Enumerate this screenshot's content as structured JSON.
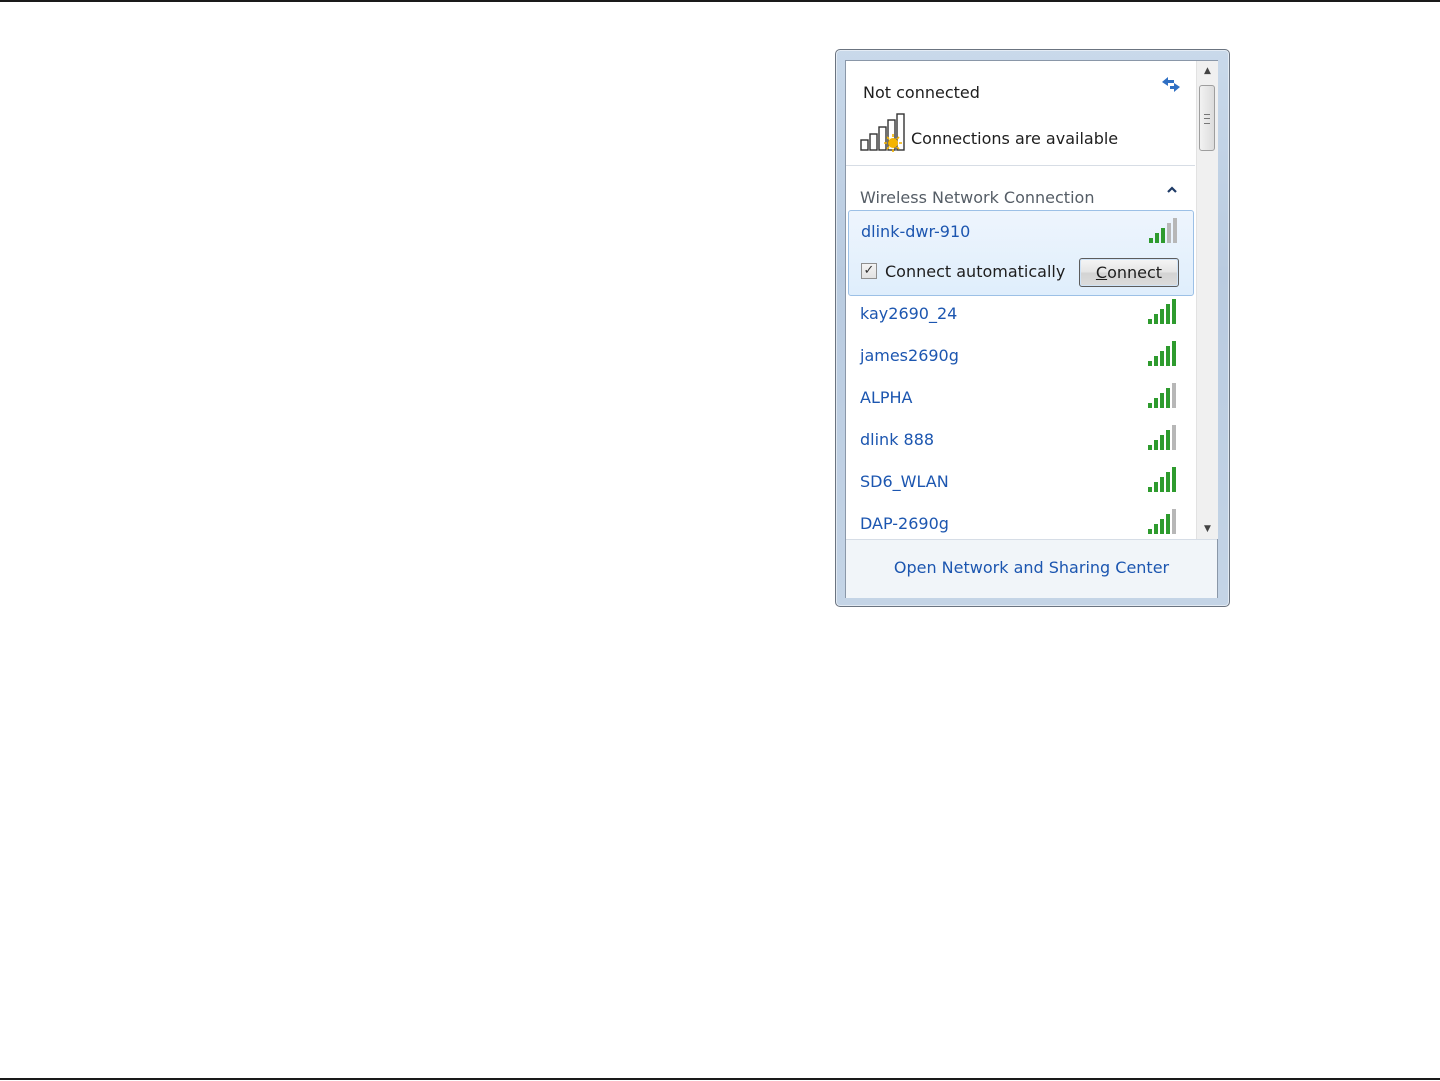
{
  "flyout": {
    "status_title": "Not connected",
    "availability_text": "Connections are available",
    "section_title": "Wireless Network Connection",
    "selected_network": {
      "name": "dlink-dwr-910",
      "signal_bars": 3,
      "connect_automatically_label": "Connect automatically",
      "connect_automatically_checked": true,
      "connect_button_label_first": "C",
      "connect_button_label_rest": "onnect"
    },
    "networks": [
      {
        "name": "kay2690_24",
        "signal_bars": 5
      },
      {
        "name": "james2690g",
        "signal_bars": 5
      },
      {
        "name": "ALPHA",
        "signal_bars": 4
      },
      {
        "name": "dlink 888",
        "signal_bars": 4
      },
      {
        "name": "SD6_WLAN",
        "signal_bars": 5
      },
      {
        "name": "DAP-2690g",
        "signal_bars": 4
      }
    ],
    "footer_link": "Open Network and Sharing Center"
  },
  "icons": {
    "refresh": "refresh-icon",
    "signal_status": "wireless-signal-warning-icon",
    "collapse": "chevron-up-icon",
    "signal": "signal-strength-icon"
  },
  "colors": {
    "link": "#1c56b0",
    "signal_green": "#2e9b2e",
    "signal_gray": "#b7b7b7",
    "selected_bg": "#dfeefc"
  }
}
